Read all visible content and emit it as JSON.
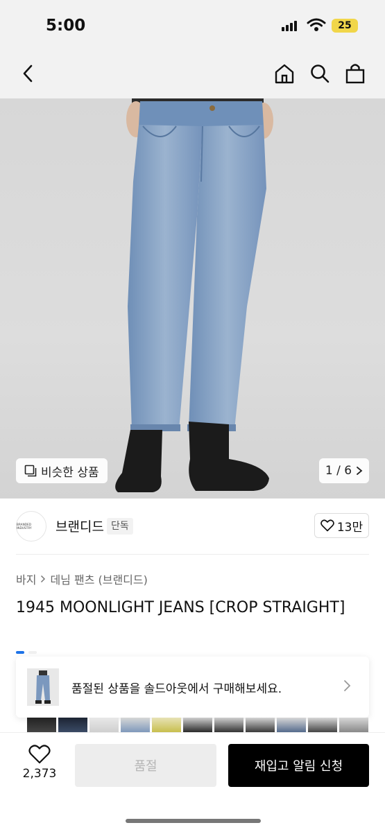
{
  "status": {
    "time": "5:00",
    "battery": "25"
  },
  "hero": {
    "similar_label": "비슷한 상품",
    "page_indicator": "1 / 6"
  },
  "brand": {
    "name": "브랜디드",
    "tag": "단독",
    "likes": "13만"
  },
  "breadcrumb": {
    "level1": "바지",
    "level2": "데님 팬츠 (브랜디드)"
  },
  "product": {
    "title": "1945 MOONLIGHT JEANS [CROP STRAIGHT]"
  },
  "soldout_banner": {
    "text": "품절된 상품을 솔드아웃에서 구매해보세요."
  },
  "bottom": {
    "wish_count": "2,373",
    "soldout_label": "품절",
    "restock_label": "재입고 알림 신청"
  },
  "colors": {
    "accent_blue": "#1e73e8",
    "primary_black": "#000000",
    "battery_yellow": "#f1d64a"
  }
}
